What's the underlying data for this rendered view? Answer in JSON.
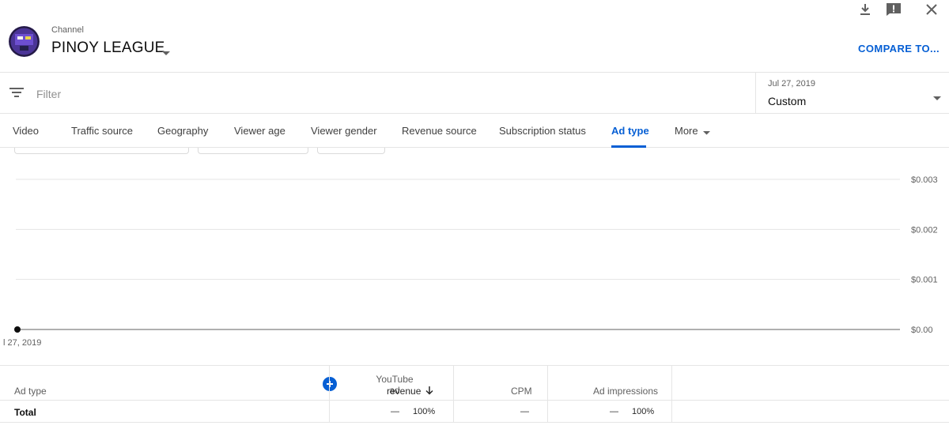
{
  "header": {
    "channel_label": "Channel",
    "channel_name": "PINOY LEAGUE",
    "compare_label": "COMPARE TO..."
  },
  "icons": [
    "download-icon",
    "feedback-icon",
    "close-icon",
    "filter-icon",
    "chevron-down-icon",
    "plus-icon",
    "arrow-down-icon"
  ],
  "filter": {
    "placeholder": "Filter"
  },
  "date_picker": {
    "range": "Jul 27, 2019",
    "preset": "Custom"
  },
  "tabs": [
    {
      "label": "Video"
    },
    {
      "label": "Traffic source"
    },
    {
      "label": "Geography"
    },
    {
      "label": "Viewer age"
    },
    {
      "label": "Viewer gender"
    },
    {
      "label": "Revenue source"
    },
    {
      "label": "Subscription status"
    },
    {
      "label": "Ad type",
      "active": true
    },
    {
      "label": "More"
    }
  ],
  "chart_data": {
    "type": "line",
    "x": [
      "Jul 27, 2019"
    ],
    "x_tick_labels": [
      "l 27, 2019"
    ],
    "y": [
      0
    ],
    "y_ticks": [
      "$0.003",
      "$0.002",
      "$0.001",
      "$0.00"
    ],
    "ylim": [
      0,
      0.003
    ],
    "grid": true
  },
  "table": {
    "columns": {
      "ad_type": "Ad type",
      "revenue_line1": "YouTube ad",
      "revenue_line2": "revenue",
      "cpm": "CPM",
      "impressions": "Ad impressions"
    },
    "total_row": {
      "label": "Total",
      "revenue_value": "—",
      "revenue_pct": "100%",
      "cpm_value": "—",
      "impressions_value": "—",
      "impressions_pct": "100%"
    }
  },
  "colors": {
    "accent": "#065fd4",
    "text": "#282828",
    "muted": "#606060",
    "divider": "#e5e5e5"
  }
}
